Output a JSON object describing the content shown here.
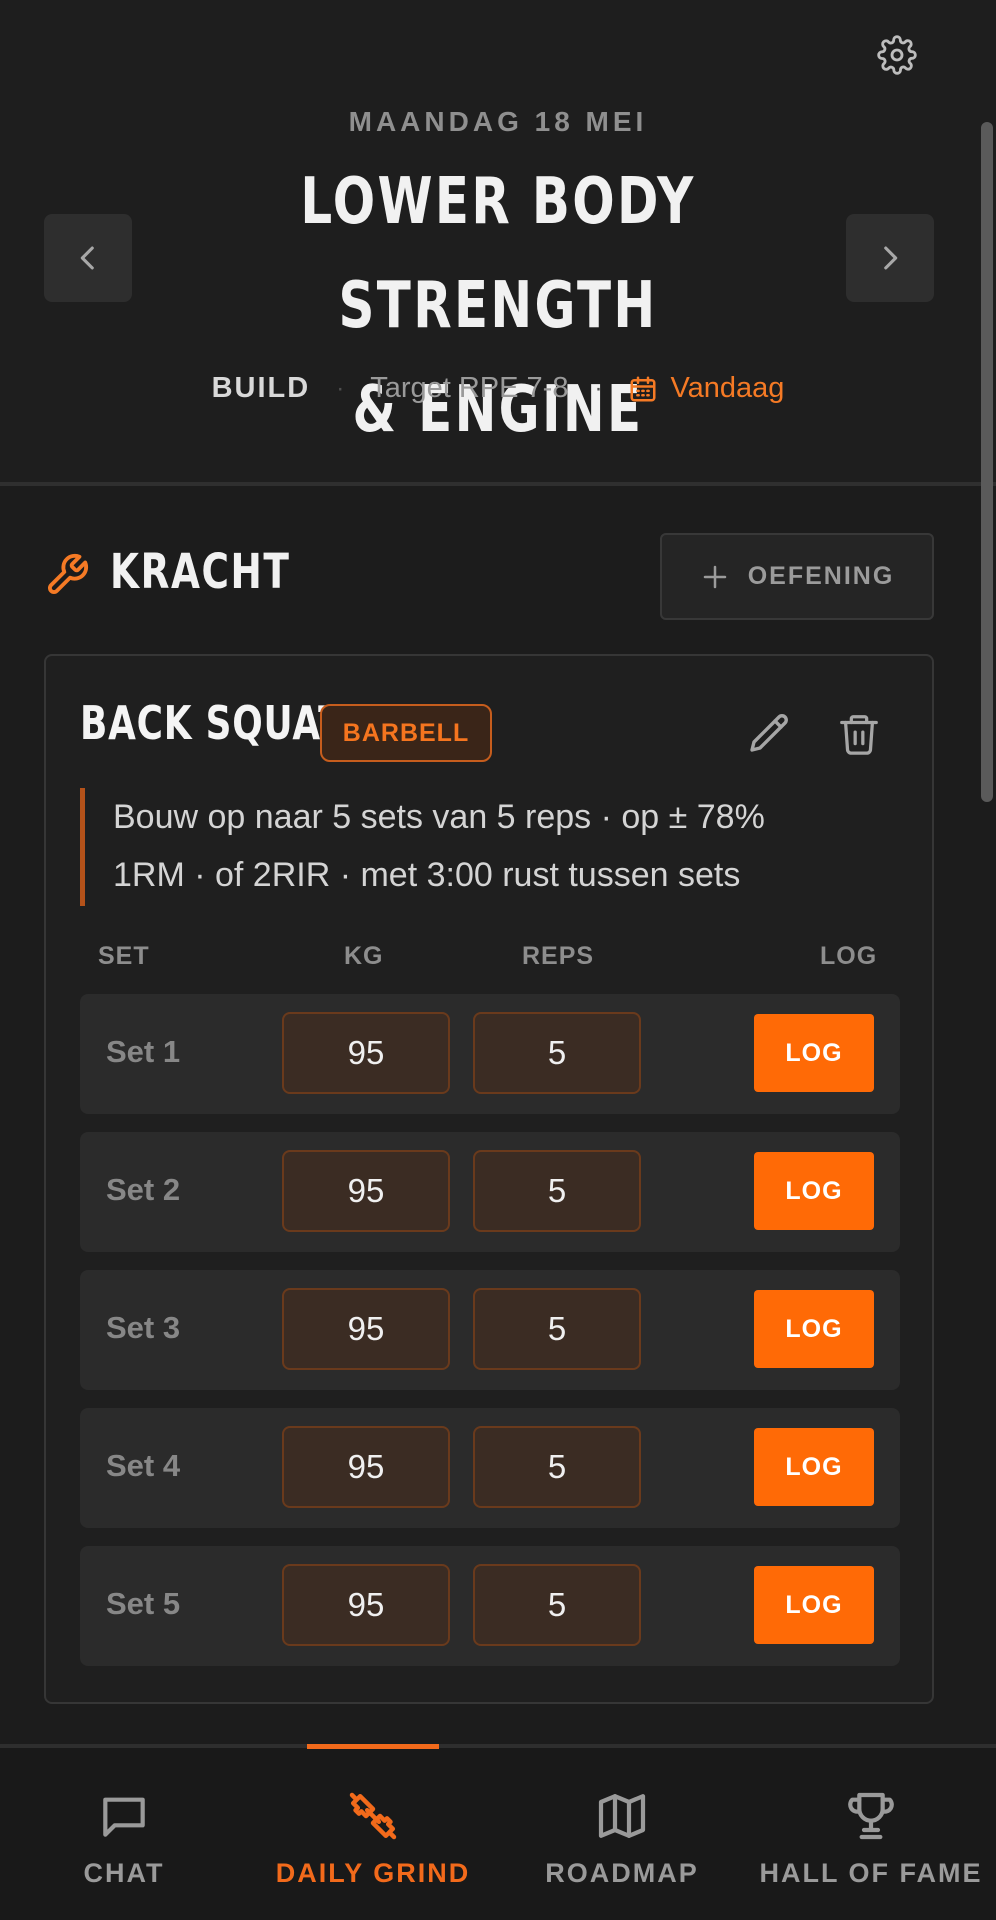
{
  "header": {
    "date": "MAANDAG 18 MEI",
    "title_line1": "LOWER BODY STRENGTH",
    "title_line2": "& ENGINE",
    "phase": "BUILD",
    "separator": "·",
    "target": "Target RPE 7-8",
    "today": "Vandaag"
  },
  "icons": {
    "settings": "gear-icon",
    "prev": "chevron-left-icon",
    "next": "chevron-right-icon",
    "calendar": "calendar-icon",
    "section": "wrench-icon",
    "add": "plus-icon",
    "edit": "pencil-icon",
    "delete": "trash-icon"
  },
  "section": {
    "title": "KRACHT",
    "add_label": "OEFENING"
  },
  "exercise": {
    "name": "BACK SQUAT",
    "equipment": "BARBELL",
    "description_line1": "Bouw op naar 5 sets van 5 reps · op ± 78%",
    "description_line2": "1RM · of 2RIR · met 3:00 rust tussen sets",
    "columns": {
      "set": "SET",
      "kg": "KG",
      "reps": "REPS",
      "log": "LOG"
    },
    "sets": [
      {
        "label": "Set 1",
        "kg": "95",
        "reps": "5",
        "log_label": "LOG"
      },
      {
        "label": "Set 2",
        "kg": "95",
        "reps": "5",
        "log_label": "LOG"
      },
      {
        "label": "Set 3",
        "kg": "95",
        "reps": "5",
        "log_label": "LOG"
      },
      {
        "label": "Set 4",
        "kg": "95",
        "reps": "5",
        "log_label": "LOG"
      },
      {
        "label": "Set 5",
        "kg": "95",
        "reps": "5",
        "log_label": "LOG"
      }
    ]
  },
  "nav": {
    "active": "daily-grind",
    "items": [
      {
        "label": "CHAT",
        "icon": "chat-bubble-icon"
      },
      {
        "label": "DAILY GRIND",
        "icon": "dumbbell-icon"
      },
      {
        "label": "ROADMAP",
        "icon": "map-icon"
      },
      {
        "label": "HALL OF FAME",
        "icon": "trophy-icon"
      }
    ]
  },
  "colors": {
    "accent": "#ff6a06",
    "accent_text": "#f57a25",
    "background": "#1c1c1c",
    "card": "#1f1f1f",
    "row": "#2b2b2b",
    "field": "#3b2c23"
  }
}
